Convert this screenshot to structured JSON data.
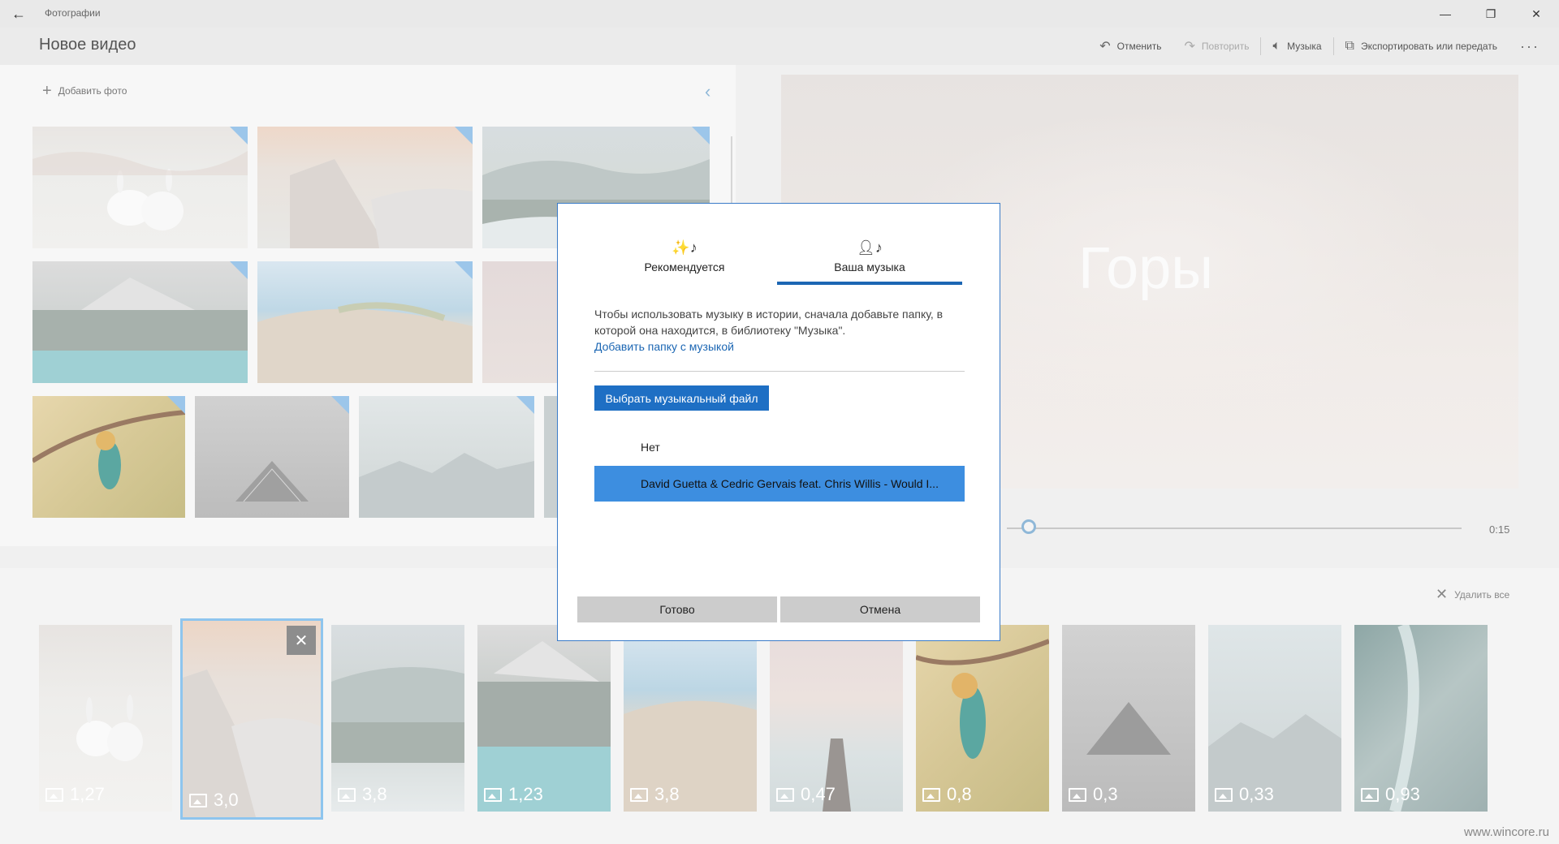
{
  "app": {
    "name": "Фотографии",
    "project_title": "Новое видео"
  },
  "window_controls": {
    "minimize": "—",
    "maximize": "❐",
    "close": "✕"
  },
  "commands": {
    "undo": "Отменить",
    "redo": "Повторить",
    "music": "Музыка",
    "export": "Экспортировать или передать",
    "more": "···"
  },
  "library": {
    "add_photo": "Добавить фото"
  },
  "preview": {
    "title_text": "Горы",
    "end_time": "0:15"
  },
  "dialog": {
    "tabs": [
      {
        "label": "Рекомендуется",
        "icon": "magic-music-icon"
      },
      {
        "label": "Ваша музыка",
        "icon": "user-music-icon"
      }
    ],
    "active_tab": 1,
    "description": "Чтобы использовать музыку в истории, сначала добавьте папку, в которой она находится, в библиотеку \"Музыка\".",
    "add_folder_link": "Добавить папку с музыкой",
    "choose_file_button": "Выбрать музыкальный файл",
    "options": [
      "Нет",
      "David Guetta & Cedric Gervais feat. Chris Willis - Would I..."
    ],
    "selected_option": 1,
    "done_button": "Готово",
    "cancel_button": "Отмена"
  },
  "storyboard": {
    "remove_all": "Удалить все",
    "cards": [
      {
        "duration": "1,27"
      },
      {
        "duration": "3,0"
      },
      {
        "duration": "3,8"
      },
      {
        "duration": "1,23"
      },
      {
        "duration": "3,8"
      },
      {
        "duration": "0,47"
      },
      {
        "duration": "0,8"
      },
      {
        "duration": "0,3"
      },
      {
        "duration": "0,33"
      },
      {
        "duration": "0,93"
      }
    ],
    "selected_card": 1
  },
  "watermark": "www.wincore.ru"
}
